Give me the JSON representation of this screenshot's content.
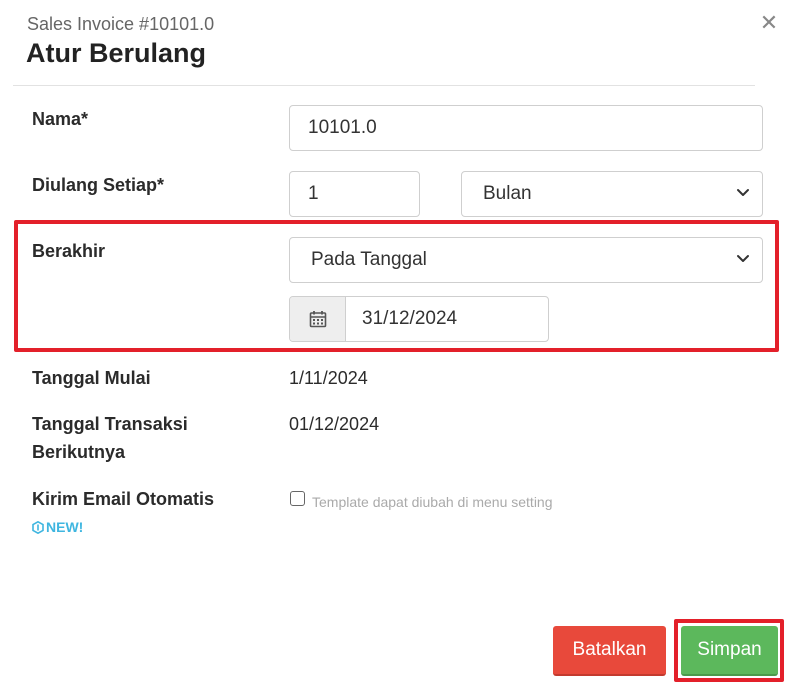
{
  "header": {
    "subtitle": "Sales Invoice #10101.0",
    "title": "Atur Berulang",
    "close_glyph": "✕"
  },
  "form": {
    "nama": {
      "label": "Nama*",
      "value": "10101.0"
    },
    "diulang": {
      "label": "Diulang Setiap*",
      "count": "1",
      "unit": "Bulan"
    },
    "berakhir": {
      "label": "Berakhir",
      "mode": "Pada Tanggal",
      "date": "31/12/2024"
    },
    "tanggal_mulai": {
      "label": "Tanggal Mulai",
      "value": "1/11/2024"
    },
    "tanggal_transaksi": {
      "label_line1": "Tanggal Transaksi",
      "label_line2": "Berikutnya",
      "value": "01/12/2024"
    },
    "kirim_email": {
      "label": "Kirim Email Otomatis",
      "badge": "NEW!",
      "hint": "Template dapat diubah di menu setting",
      "checked": false
    }
  },
  "buttons": {
    "cancel": "Batalkan",
    "save": "Simpan"
  },
  "colors": {
    "cancel": "#e8493b",
    "save": "#5cb85c",
    "highlight": "#e3202a",
    "badge": "#3fb6e0"
  },
  "icons": {
    "close": "close-icon",
    "calendar": "calendar-icon",
    "chevron": "chevron-down-icon",
    "new": "new-badge-icon"
  }
}
